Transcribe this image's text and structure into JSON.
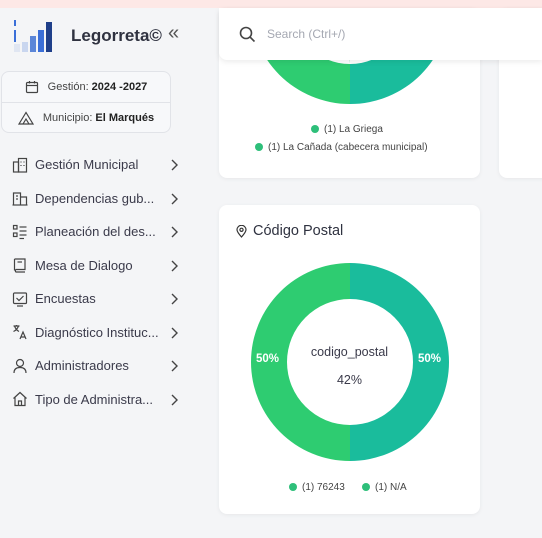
{
  "app": {
    "name": "Legorreta©"
  },
  "info": {
    "gestion_label": "Gestión:",
    "gestion_value": "2024 -2027",
    "municipio_label": "Municipio:",
    "municipio_value": "El Marqués"
  },
  "menu": [
    {
      "label": "Gestión Municipal",
      "icon": "building-grid-icon"
    },
    {
      "label": "Dependencias gub...",
      "icon": "buildings-icon"
    },
    {
      "label": "Planeación del des...",
      "icon": "checklist-icon"
    },
    {
      "label": "Mesa de Dialogo",
      "icon": "book-icon"
    },
    {
      "label": "Encuestas",
      "icon": "survey-check-icon"
    },
    {
      "label": "Diagnóstico Instituc...",
      "icon": "translate-icon"
    },
    {
      "label": "Administradores",
      "icon": "user-icon"
    },
    {
      "label": "Tipo de Administra...",
      "icon": "home-icon"
    }
  ],
  "search": {
    "placeholder": "Search (Ctrl+/)"
  },
  "card_top": {
    "legend": [
      "(1) La Griega",
      "(1) La Cañada (cabecera municipal)"
    ]
  },
  "colors": {
    "green": "#2ecc71",
    "teal": "#1abc9c",
    "legend_dot": "#2ebf7a"
  },
  "card_postal": {
    "title": "Código Postal",
    "center_title": "codigo_postal",
    "center_value": "42%",
    "slice_left_label": "50%",
    "slice_right_label": "50%",
    "legend": [
      "(1) 76243",
      "(1) N/A"
    ]
  },
  "chart_data": {
    "type": "pie",
    "title": "Código Postal",
    "categories": [
      "76243",
      "N/A"
    ],
    "values": [
      1,
      1
    ],
    "percent_labels": [
      "50%",
      "50%"
    ],
    "center_text": [
      "codigo_postal",
      "42%"
    ],
    "colors": [
      "#2ecc71",
      "#1abc9c"
    ]
  }
}
